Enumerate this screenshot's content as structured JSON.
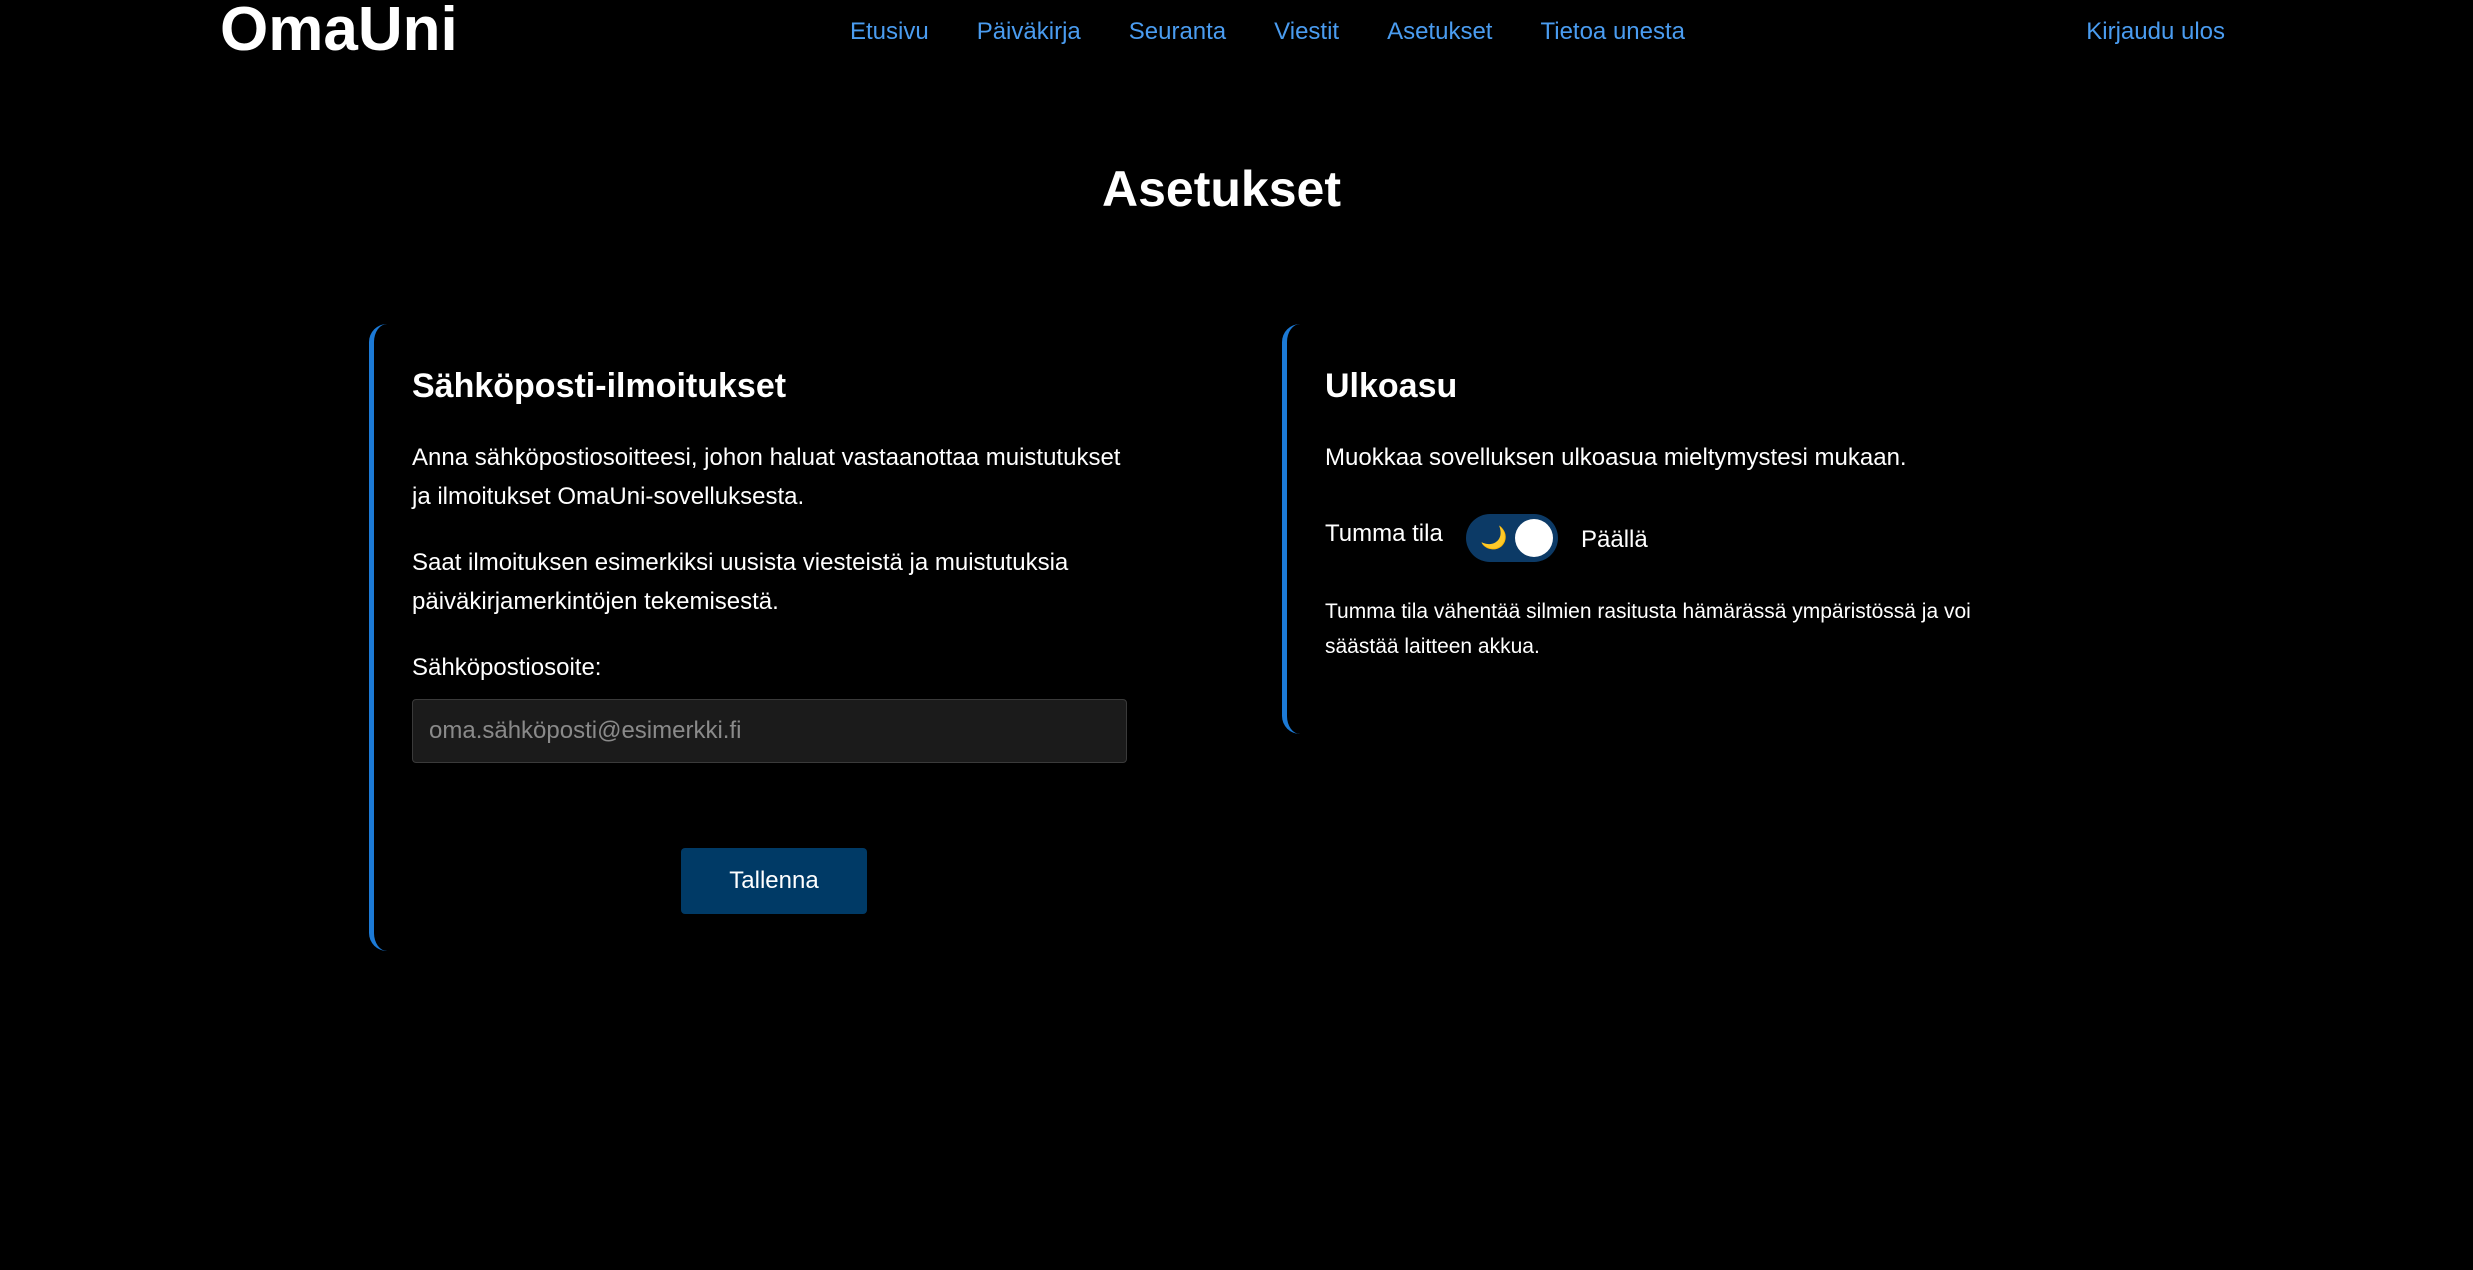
{
  "header": {
    "logo": "OmaUni",
    "nav": [
      "Etusivu",
      "Päiväkirja",
      "Seuranta",
      "Viestit",
      "Asetukset",
      "Tietoa unesta"
    ],
    "logout": "Kirjaudu ulos"
  },
  "page": {
    "title": "Asetukset"
  },
  "email_card": {
    "title": "Sähköposti-ilmoitukset",
    "para1": "Anna sähköpostiosoitteesi, johon haluat vastaanottaa muistutukset ja ilmoitukset OmaUni-sovelluksesta.",
    "para2": "Saat ilmoituksen esimerkiksi uusista viesteistä ja muistutuksia päiväkirjamerkintöjen tekemisestä.",
    "field_label": "Sähköpostiosoite:",
    "placeholder": "oma.sähköposti@esimerkki.fi",
    "value": "",
    "save_label": "Tallenna"
  },
  "appearance_card": {
    "title": "Ulkoasu",
    "description": "Muokkaa sovelluksen ulkoasua mieltymystesi mukaan.",
    "toggle_label": "Tumma tila",
    "toggle_icon": "moon-icon",
    "toggle_on": true,
    "toggle_state": "Päällä",
    "note": "Tumma tila vähentää silmien rasitusta hämärässä ympäristössä ja voi säästää laitteen akkua."
  },
  "colors": {
    "background": "#000000",
    "link": "#4a9cf0",
    "accent_border": "#1c7ad6",
    "button": "#003a66",
    "toggle_track": "#0c3a66"
  }
}
